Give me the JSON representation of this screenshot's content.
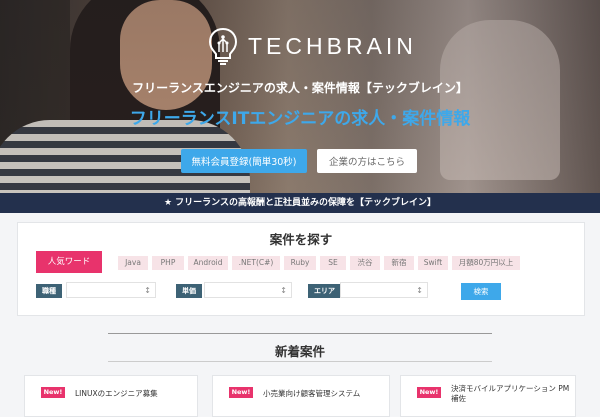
{
  "hero": {
    "logo_text": "TECHBRAIN",
    "tagline": "フリーランスエンジニアの求人・案件情報【テックブレイン】",
    "headline": "フリーランスITエンジニアの求人・案件情報",
    "primary_button": "無料会員登録(簡単30秒)",
    "secondary_button": "企業の方はこちら"
  },
  "banner": "★ フリーランスの高報酬と正社員並みの保障を【テックブレイン】",
  "search": {
    "title": "案件を探す",
    "popular_label": "人気ワード",
    "keywords": [
      "Java",
      "PHP",
      "Android",
      ".NET(C#)",
      "Ruby",
      "SE",
      "渋谷",
      "新宿",
      "Swift",
      "月額80万円以上"
    ],
    "filters": [
      {
        "label": "職種",
        "value": "↕"
      },
      {
        "label": "単価",
        "value": "↕"
      },
      {
        "label": "エリア",
        "value": "↕"
      }
    ],
    "search_button": "検索"
  },
  "new_listings": {
    "title": "新着案件",
    "badge": "New!",
    "items": [
      {
        "title": "LINUXのエンジニア募集"
      },
      {
        "title": "小売業向け顧客管理システム"
      },
      {
        "title": "決済モバイルアプリケーション PM補佐"
      }
    ]
  },
  "colors": {
    "accent_blue": "#3ea8ea",
    "pink": "#e8336c",
    "navy": "#23304d",
    "filter_label": "#3d6275"
  }
}
